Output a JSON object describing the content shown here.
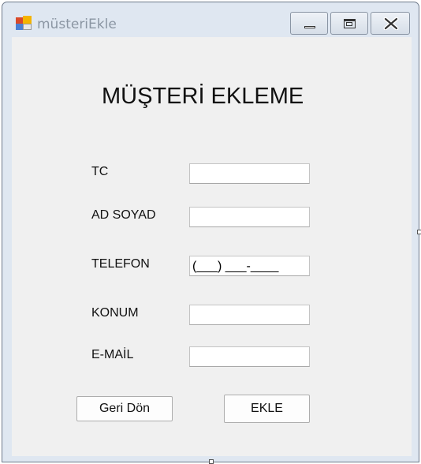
{
  "window": {
    "title": "müsteriEkle",
    "minimize_label": "Minimize",
    "maximize_label": "Maximize",
    "close_label": "Close"
  },
  "form": {
    "heading": "MÜŞTERİ EKLEME",
    "fields": [
      {
        "label": "TC",
        "value": ""
      },
      {
        "label": "AD SOYAD",
        "value": ""
      },
      {
        "label": "TELEFON",
        "value": "(___) ___-____"
      },
      {
        "label": "KONUM",
        "value": ""
      },
      {
        "label": "E-MAİL",
        "value": ""
      }
    ],
    "back_button": "Geri Dön",
    "add_button": "EKLE"
  },
  "colors": {
    "window_frame": "#dfe7f1",
    "client_area": "#f0f0f0",
    "title_text": "#8b96a3"
  },
  "icons": [
    "app-icon",
    "minimize-icon",
    "maximize-icon",
    "close-icon"
  ]
}
